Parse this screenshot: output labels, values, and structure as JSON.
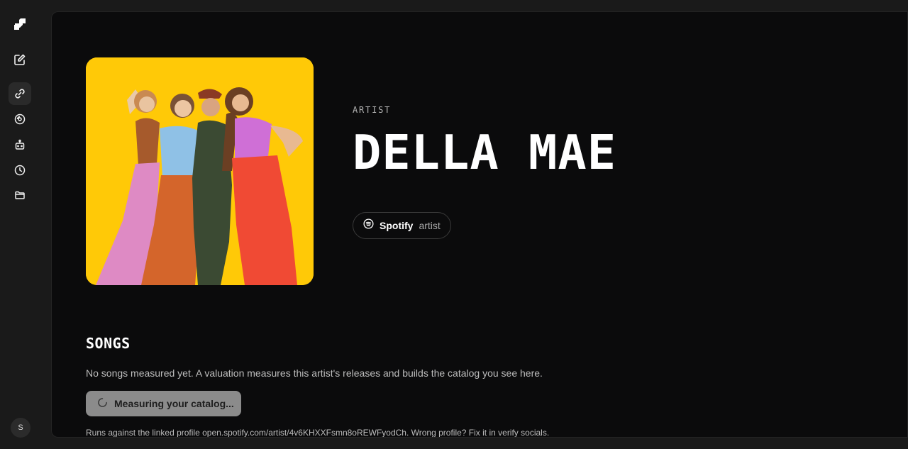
{
  "sidebar": {
    "items": [
      {
        "icon": "logo-icon"
      },
      {
        "icon": "edit-icon"
      },
      {
        "icon": "link-icon"
      },
      {
        "icon": "vinyl-icon"
      },
      {
        "icon": "robot-icon"
      },
      {
        "icon": "clock-icon"
      },
      {
        "icon": "folder-icon"
      }
    ],
    "avatar_initial": "S"
  },
  "artist": {
    "eyebrow": "ARTIST",
    "name": "DELLA MAE",
    "image_background": "#ffc907"
  },
  "source": {
    "icon": "spotify-icon",
    "name": "Spotify",
    "kind": "artist"
  },
  "songs": {
    "heading": "SONGS",
    "empty_text": "No songs measured yet. A valuation measures this artist's releases and builds the catalog you see here.",
    "button_label": "Measuring your catalog...",
    "footnote": "Runs against the linked profile open.spotify.com/artist/4v6KHXXFsmn8oREWFyodCh. Wrong profile? Fix it in verify socials."
  },
  "colors": {
    "page_background": "#1a1a1a",
    "panel_background": "#0b0b0c",
    "button_disabled": "#8b8b8b"
  }
}
